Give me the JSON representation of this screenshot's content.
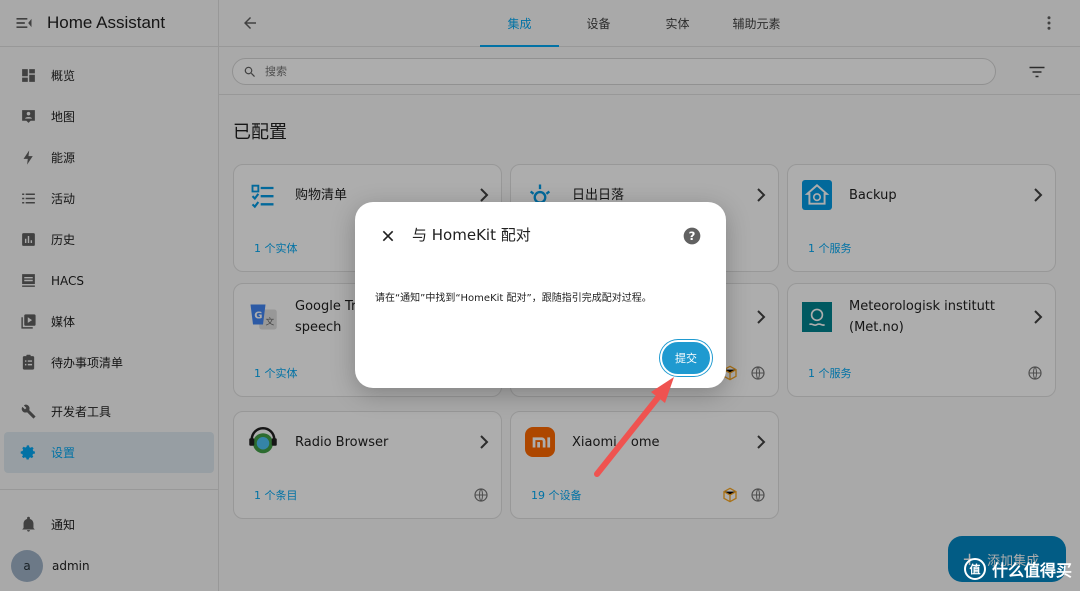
{
  "app": {
    "title": "Home Assistant"
  },
  "sidebar": {
    "items": [
      {
        "label": "概览",
        "icon": "dashboard-icon"
      },
      {
        "label": "地图",
        "icon": "map-icon"
      },
      {
        "label": "能源",
        "icon": "lightning-icon"
      },
      {
        "label": "活动",
        "icon": "list-icon"
      },
      {
        "label": "历史",
        "icon": "chart-icon"
      },
      {
        "label": "HACS",
        "icon": "hacs-icon"
      },
      {
        "label": "媒体",
        "icon": "media-icon"
      },
      {
        "label": "待办事项清单",
        "icon": "clipboard-icon"
      },
      {
        "label": "开发者工具",
        "icon": "wrench-icon"
      },
      {
        "label": "设置",
        "icon": "gear-icon"
      }
    ],
    "notifications_label": "通知",
    "user": {
      "initial": "a",
      "name": "admin"
    }
  },
  "tabs": [
    "集成",
    "设备",
    "实体",
    "辅助元素"
  ],
  "search": {
    "placeholder": "搜索"
  },
  "section_title": "已配置",
  "cards": [
    {
      "name": "购物清单",
      "link": "1 个实体"
    },
    {
      "name": "日出日落",
      "link": ""
    },
    {
      "name": "Backup",
      "link": "1 个服务"
    },
    {
      "name": "Google Translate text-to-speech",
      "name_visible_1": "Google Tra",
      "name_visible_2": "speech",
      "link": "1 个实体"
    },
    {
      "name": "",
      "link": ""
    },
    {
      "name": "Meteorologisk institutt (Met.no)",
      "name_line_1": "Meteorologisk institutt",
      "name_line_2": "(Met.no)",
      "link": "1 个服务"
    },
    {
      "name": "Radio Browser",
      "link": "1 个条目"
    },
    {
      "name": "Xiaomi Home",
      "name_visible_1": "Xiaomi ",
      "name_visible_2": "ome",
      "link": "19 个设备"
    }
  ],
  "fab": {
    "label": "添加集成"
  },
  "dialog": {
    "title": "与 HomeKit 配对",
    "body": "请在“通知”中找到“HomeKit 配对”，跟随指引完成配对过程。",
    "submit_label": "提交"
  },
  "watermark": {
    "text": "什么值得买",
    "badge": "值"
  },
  "colors": {
    "accent": "#03a9f4",
    "arrow": "#ef5350",
    "submit": "#1f9ad0"
  }
}
